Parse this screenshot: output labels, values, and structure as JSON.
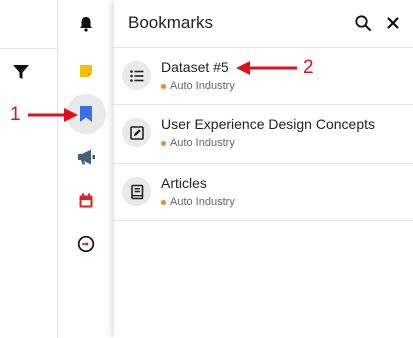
{
  "panel": {
    "title": "Bookmarks"
  },
  "bookmarks": [
    {
      "title": "Dataset #5",
      "subtitle": "Auto Industry",
      "icon": "list-icon"
    },
    {
      "title": "User Experience Design Concepts",
      "subtitle": "Auto Industry",
      "icon": "edit-square-icon"
    },
    {
      "title": "Articles",
      "subtitle": "Auto Industry",
      "icon": "book-icon"
    }
  ],
  "rail": [
    {
      "icon": "bell-icon",
      "active": false
    },
    {
      "icon": "sticky-note-icon",
      "active": false
    },
    {
      "icon": "bookmark-icon",
      "active": true
    },
    {
      "icon": "megaphone-icon",
      "active": false
    },
    {
      "icon": "calendar-icon",
      "active": false
    },
    {
      "icon": "gauge-icon",
      "active": false
    }
  ],
  "annotations": {
    "label_1": "1",
    "label_2": "2"
  },
  "colors": {
    "accent_blue": "#3b6fe6",
    "sticky_yellow": "#f5c000",
    "calendar_red": "#e02020",
    "dot_orange": "#f0882b",
    "annotation_red": "#e0101a",
    "megaphone_blue": "#46617a"
  }
}
